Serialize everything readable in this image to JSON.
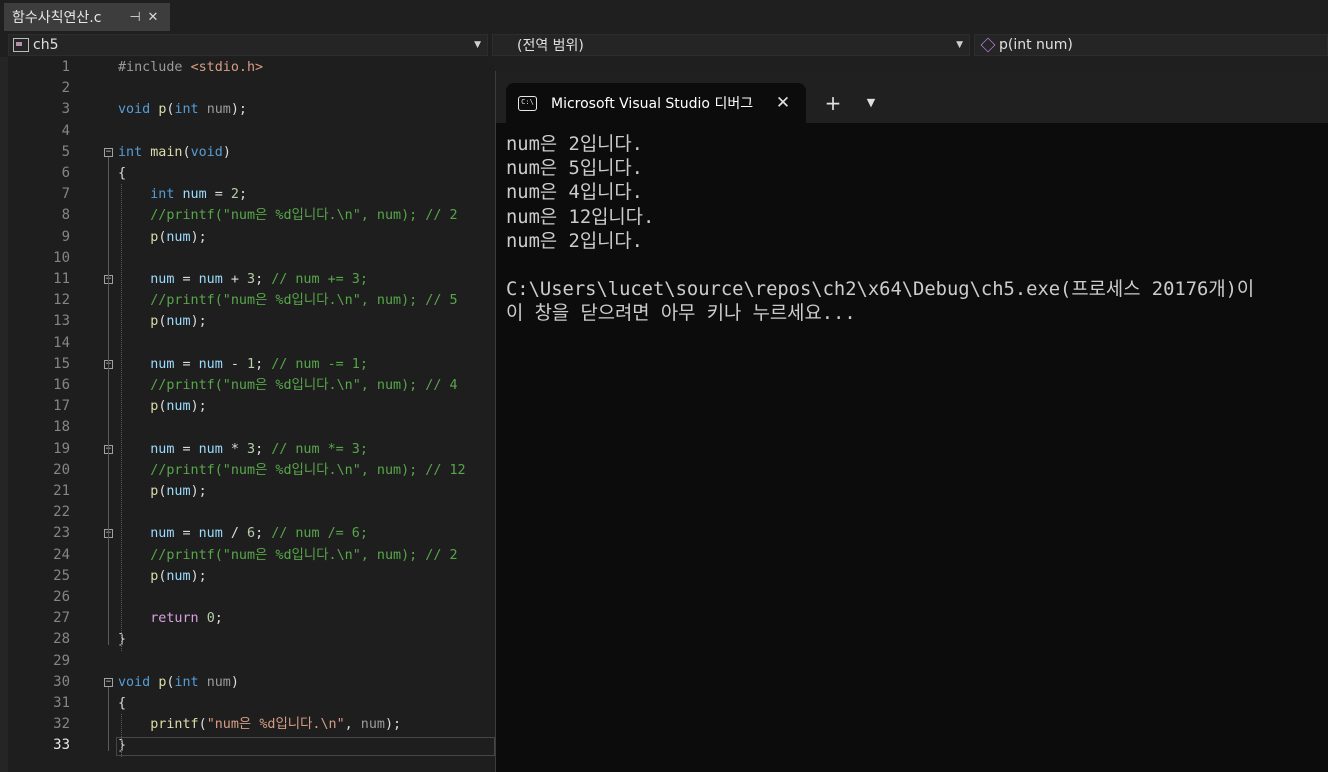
{
  "file_tab": {
    "label": "함수사칙연산.c",
    "pin_glyph": "⊣",
    "close_glyph": "✕"
  },
  "navbar": {
    "project": "ch5",
    "scope": "(전역 범위)",
    "member": "p(int num)"
  },
  "editor": {
    "current_line": 33,
    "lines": [
      {
        "n": "1",
        "t": [
          [
            "pp",
            "#include "
          ],
          [
            "s",
            "<stdio.h>"
          ]
        ]
      },
      {
        "n": "2",
        "t": []
      },
      {
        "n": "3",
        "t": [
          [
            "k",
            "void "
          ],
          [
            "f",
            "p"
          ],
          [
            "",
            "("
          ],
          [
            "k",
            "int "
          ],
          [
            "p",
            "num"
          ],
          [
            "",
            ");"
          ]
        ]
      },
      {
        "n": "4",
        "t": []
      },
      {
        "n": "5",
        "t": [
          [
            "k",
            "int "
          ],
          [
            "f",
            "main"
          ],
          [
            "",
            "("
          ],
          [
            "k",
            "void"
          ],
          [
            "",
            ")"
          ]
        ]
      },
      {
        "n": "6",
        "t": [
          [
            "",
            "{"
          ]
        ]
      },
      {
        "n": "7",
        "t": [
          [
            "",
            "    "
          ],
          [
            "k",
            "int "
          ],
          [
            "v",
            "num"
          ],
          [
            "",
            " = "
          ],
          [
            "n",
            "2"
          ],
          [
            "",
            ";"
          ]
        ]
      },
      {
        "n": "8",
        "t": [
          [
            "",
            "    "
          ],
          [
            "c",
            "//printf(\"num은 %d입니다.\\n\", num); // 2"
          ]
        ]
      },
      {
        "n": "9",
        "t": [
          [
            "",
            "    "
          ],
          [
            "f",
            "p"
          ],
          [
            "",
            "("
          ],
          [
            "v",
            "num"
          ],
          [
            "",
            ");"
          ]
        ]
      },
      {
        "n": "10",
        "t": []
      },
      {
        "n": "11",
        "t": [
          [
            "",
            "    "
          ],
          [
            "v",
            "num"
          ],
          [
            "",
            " = "
          ],
          [
            "v",
            "num"
          ],
          [
            "",
            " + "
          ],
          [
            "n",
            "3"
          ],
          [
            "",
            "; "
          ],
          [
            "c",
            "// num += 3;"
          ]
        ]
      },
      {
        "n": "12",
        "t": [
          [
            "",
            "    "
          ],
          [
            "c",
            "//printf(\"num은 %d입니다.\\n\", num); // 5"
          ]
        ]
      },
      {
        "n": "13",
        "t": [
          [
            "",
            "    "
          ],
          [
            "f",
            "p"
          ],
          [
            "",
            "("
          ],
          [
            "v",
            "num"
          ],
          [
            "",
            ");"
          ]
        ]
      },
      {
        "n": "14",
        "t": []
      },
      {
        "n": "15",
        "t": [
          [
            "",
            "    "
          ],
          [
            "v",
            "num"
          ],
          [
            "",
            " = "
          ],
          [
            "v",
            "num"
          ],
          [
            "",
            " - "
          ],
          [
            "n",
            "1"
          ],
          [
            "",
            "; "
          ],
          [
            "c",
            "// num -= 1;"
          ]
        ]
      },
      {
        "n": "16",
        "t": [
          [
            "",
            "    "
          ],
          [
            "c",
            "//printf(\"num은 %d입니다.\\n\", num); // 4"
          ]
        ]
      },
      {
        "n": "17",
        "t": [
          [
            "",
            "    "
          ],
          [
            "f",
            "p"
          ],
          [
            "",
            "("
          ],
          [
            "v",
            "num"
          ],
          [
            "",
            ");"
          ]
        ]
      },
      {
        "n": "18",
        "t": []
      },
      {
        "n": "19",
        "t": [
          [
            "",
            "    "
          ],
          [
            "v",
            "num"
          ],
          [
            "",
            " = "
          ],
          [
            "v",
            "num"
          ],
          [
            "",
            " * "
          ],
          [
            "n",
            "3"
          ],
          [
            "",
            "; "
          ],
          [
            "c",
            "// num *= 3;"
          ]
        ]
      },
      {
        "n": "20",
        "t": [
          [
            "",
            "    "
          ],
          [
            "c",
            "//printf(\"num은 %d입니다.\\n\", num); // 12"
          ]
        ]
      },
      {
        "n": "21",
        "t": [
          [
            "",
            "    "
          ],
          [
            "f",
            "p"
          ],
          [
            "",
            "("
          ],
          [
            "v",
            "num"
          ],
          [
            "",
            ");"
          ]
        ]
      },
      {
        "n": "22",
        "t": []
      },
      {
        "n": "23",
        "t": [
          [
            "",
            "    "
          ],
          [
            "v",
            "num"
          ],
          [
            "",
            " = "
          ],
          [
            "v",
            "num"
          ],
          [
            "",
            " / "
          ],
          [
            "n",
            "6"
          ],
          [
            "",
            "; "
          ],
          [
            "c",
            "// num /= 6;"
          ]
        ]
      },
      {
        "n": "24",
        "t": [
          [
            "",
            "    "
          ],
          [
            "c",
            "//printf(\"num은 %d입니다.\\n\", num); // 2"
          ]
        ]
      },
      {
        "n": "25",
        "t": [
          [
            "",
            "    "
          ],
          [
            "f",
            "p"
          ],
          [
            "",
            "("
          ],
          [
            "v",
            "num"
          ],
          [
            "",
            ");"
          ]
        ]
      },
      {
        "n": "26",
        "t": []
      },
      {
        "n": "27",
        "t": [
          [
            "",
            "    "
          ],
          [
            "kc",
            "return "
          ],
          [
            "n",
            "0"
          ],
          [
            "",
            ";"
          ]
        ]
      },
      {
        "n": "28",
        "t": [
          [
            "",
            "}"
          ]
        ]
      },
      {
        "n": "29",
        "t": []
      },
      {
        "n": "30",
        "t": [
          [
            "k",
            "void "
          ],
          [
            "f",
            "p"
          ],
          [
            "",
            "("
          ],
          [
            "k",
            "int "
          ],
          [
            "p",
            "num"
          ],
          [
            "",
            ")"
          ]
        ]
      },
      {
        "n": "31",
        "t": [
          [
            "",
            "{"
          ]
        ]
      },
      {
        "n": "32",
        "t": [
          [
            "",
            "    "
          ],
          [
            "f",
            "printf"
          ],
          [
            "",
            "("
          ],
          [
            "s",
            "\"num은 %d입니다.\\n\""
          ],
          [
            "",
            ", "
          ],
          [
            "p",
            "num"
          ],
          [
            "",
            ");"
          ]
        ]
      },
      {
        "n": "33",
        "t": [
          [
            "",
            "}"
          ]
        ]
      }
    ]
  },
  "console": {
    "tab_title": "Microsoft Visual Studio 디버그",
    "icon_text": "C:\\",
    "close_glyph": "✕",
    "new_tab_glyph": "+",
    "dropdown_glyph": "⌄",
    "output": [
      "num은 2입니다.",
      "num은 5입니다.",
      "num은 4입니다.",
      "num은 12입니다.",
      "num은 2입니다.",
      "",
      "C:\\Users\\lucet\\source\\repos\\ch2\\x64\\Debug\\ch5.exe(프로세스 20176개)이",
      "이 창을 닫으려면 아무 키나 누르세요..."
    ]
  },
  "icons": [
    "pin-icon",
    "close-icon",
    "project-icon",
    "cube-icon",
    "chevron-down-icon",
    "console-app-icon",
    "plus-icon"
  ]
}
